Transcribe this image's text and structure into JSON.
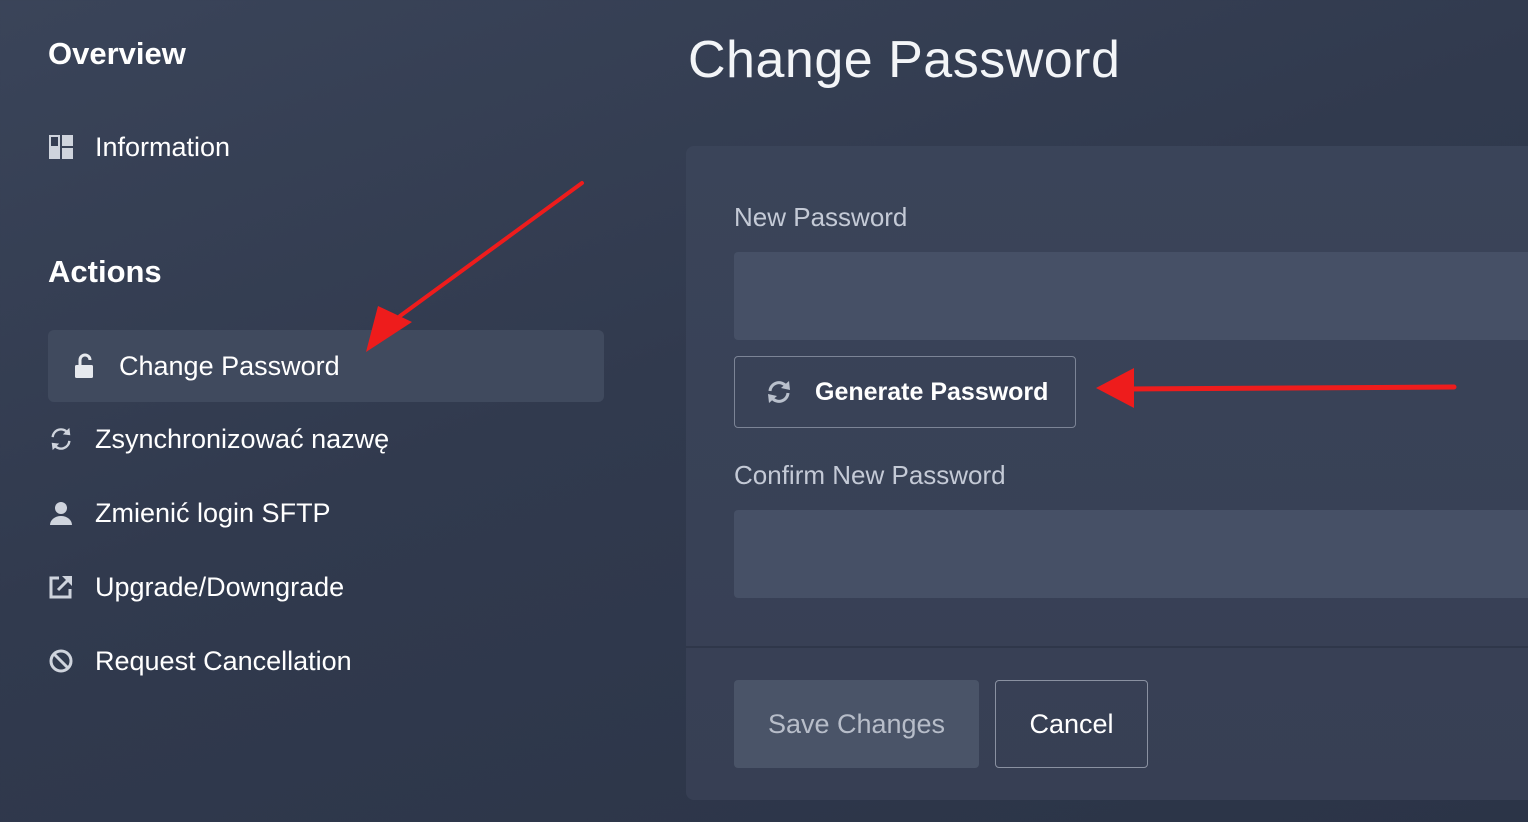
{
  "sidebar": {
    "overview_title": "Overview",
    "information_label": "Information",
    "actions_title": "Actions",
    "actions": [
      {
        "label": "Change Password",
        "icon": "unlock-icon",
        "active": true
      },
      {
        "label": "Zsynchronizować nazwę",
        "icon": "sync-icon"
      },
      {
        "label": "Zmienić login SFTP",
        "icon": "user-icon"
      },
      {
        "label": "Upgrade/Downgrade",
        "icon": "external-link-icon"
      },
      {
        "label": "Request Cancellation",
        "icon": "ban-icon"
      }
    ]
  },
  "main": {
    "title": "Change Password",
    "new_password_label": "New Password",
    "new_password_value": "",
    "generate_button": "Generate Password",
    "confirm_password_label": "Confirm New Password",
    "confirm_password_value": "",
    "save_button": "Save Changes",
    "cancel_button": "Cancel"
  },
  "colors": {
    "background": "#323b50",
    "active_item": "#404a5e",
    "annotation_arrow": "#ee1c1c"
  }
}
